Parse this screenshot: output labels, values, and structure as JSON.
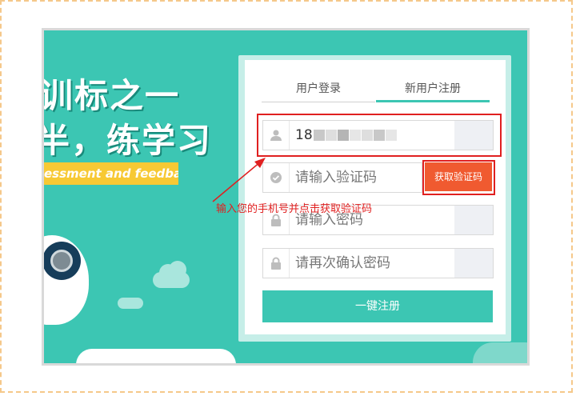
{
  "hero": {
    "line1": "训标之一",
    "line2": "半，练学习",
    "banner": "essment and feedback!"
  },
  "tabs": {
    "login": "用户登录",
    "register": "新用户注册"
  },
  "form": {
    "phone": {
      "value": "18",
      "icon": "user-icon"
    },
    "code": {
      "placeholder": "请输入验证码",
      "icon": "check-shield-icon",
      "button": "获取验证码"
    },
    "password": {
      "placeholder": "请输入密码",
      "icon": "lock-icon"
    },
    "confirm": {
      "placeholder": "请再次确认密码",
      "icon": "lock-icon"
    },
    "submit": "一键注册"
  },
  "annotation": {
    "text": "输入您的手机号并点击获取验证码"
  },
  "colors": {
    "teal": "#3cc6b3",
    "orange": "#f05a30",
    "red": "#e02020"
  }
}
